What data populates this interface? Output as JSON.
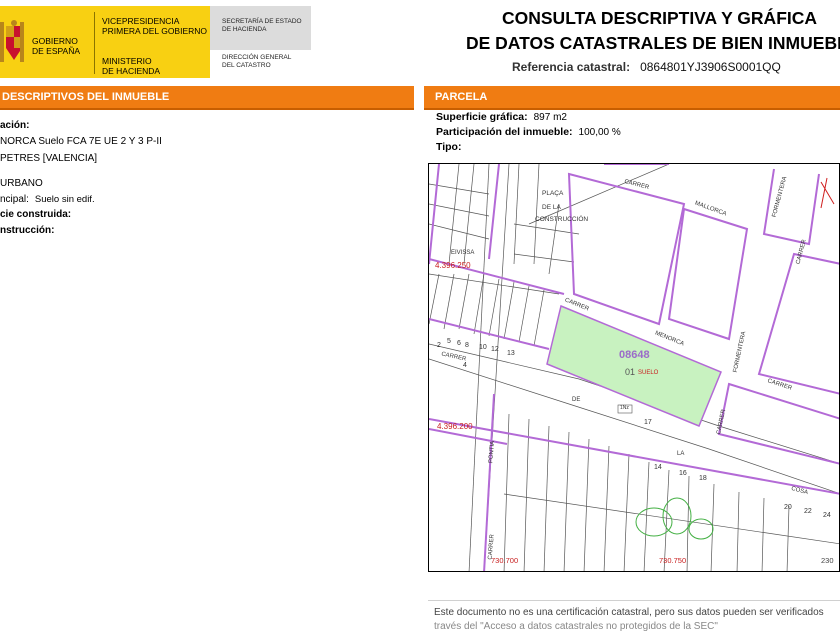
{
  "header": {
    "gobierno": "GOBIERNO\nDE ESPAÑA",
    "vicepresidencia": "VICEPRESIDENCIA\nPRIMERA DEL GOBIERNO",
    "ministerio": "MINISTERIO\nDE HACIENDA",
    "secretaria": "SECRETARÍA DE ESTADO\nDE HACIENDA",
    "direccion": "DIRECCIÓN GENERAL\nDEL CATASTRO",
    "title_line1": "CONSULTA DESCRIPTIVA Y GRÁFICA",
    "title_line2": "DE DATOS CATASTRALES DE BIEN INMUEBLE",
    "ref_label": "Referencia catastral:",
    "ref_value": "0864801YJ3906S0001QQ"
  },
  "left": {
    "bar_title": "DESCRIPTIVOS DEL INMUEBLE",
    "loc_label": "ación:",
    "loc_line1": "NORCA  Suelo FCA 7E UE 2 Y 3 P-II",
    "loc_line2": "PETRES [VALENCIA]",
    "clase": "URBANO",
    "uso_label": "ncipal:",
    "uso_value": "Suelo sin edif.",
    "sup_label": "cie construida:",
    "ano_label": "nstrucción:"
  },
  "right": {
    "bar_title": "PARCELA",
    "sup_label": "Superficie gráfica:",
    "sup_value": "897 m2",
    "part_label": "Participación del inmueble:",
    "part_value": "100,00 %",
    "tipo_label": "Tipo:"
  },
  "map": {
    "parcel_id": "08648",
    "parcel_sub": "01",
    "parcel_tag": "SUELO",
    "plaza_l1": "PLAÇA",
    "plaza_l2": "DE LA",
    "plaza_l3": "CONSTRUCCIÓN",
    "coord_a": "4.396.250",
    "coord_b": "4.396.200",
    "coord_c": "730.700",
    "coord_d": "730.750",
    "coord_e": "230",
    "street_carrer": "CARRER",
    "street_mallorca": "MALLORCA",
    "street_formentera": "FORMENTERA",
    "street_menorca": "MENORCA",
    "street_de": "DE",
    "street_la": "LA",
    "street_cosa": "COSA",
    "street_eivissa": "EIVISSA",
    "street_pontia": "PONTIA",
    "box_mark": "1Nz",
    "num_17": "17",
    "num_18": "18",
    "num_20": "20",
    "num_22": "22",
    "num_24": "24",
    "num_13": "13",
    "num_14": "14",
    "num_16": "16",
    "num_12": "12",
    "num_10": "10",
    "num_8": "8",
    "num_6": "6",
    "num_5": "5",
    "num_4": "4",
    "num_2": "2"
  },
  "footer": {
    "line1": "Este documento no es una certificación catastral, pero sus datos pueden ser verificados",
    "line2": "través del \"Acceso a datos catastrales no protegidos de la SEC\""
  },
  "colors": {
    "accent": "#f07c12",
    "logo_yellow": "#f8d012",
    "parcel_fill": "#c8f2c0",
    "block_line": "#b36ad6"
  }
}
